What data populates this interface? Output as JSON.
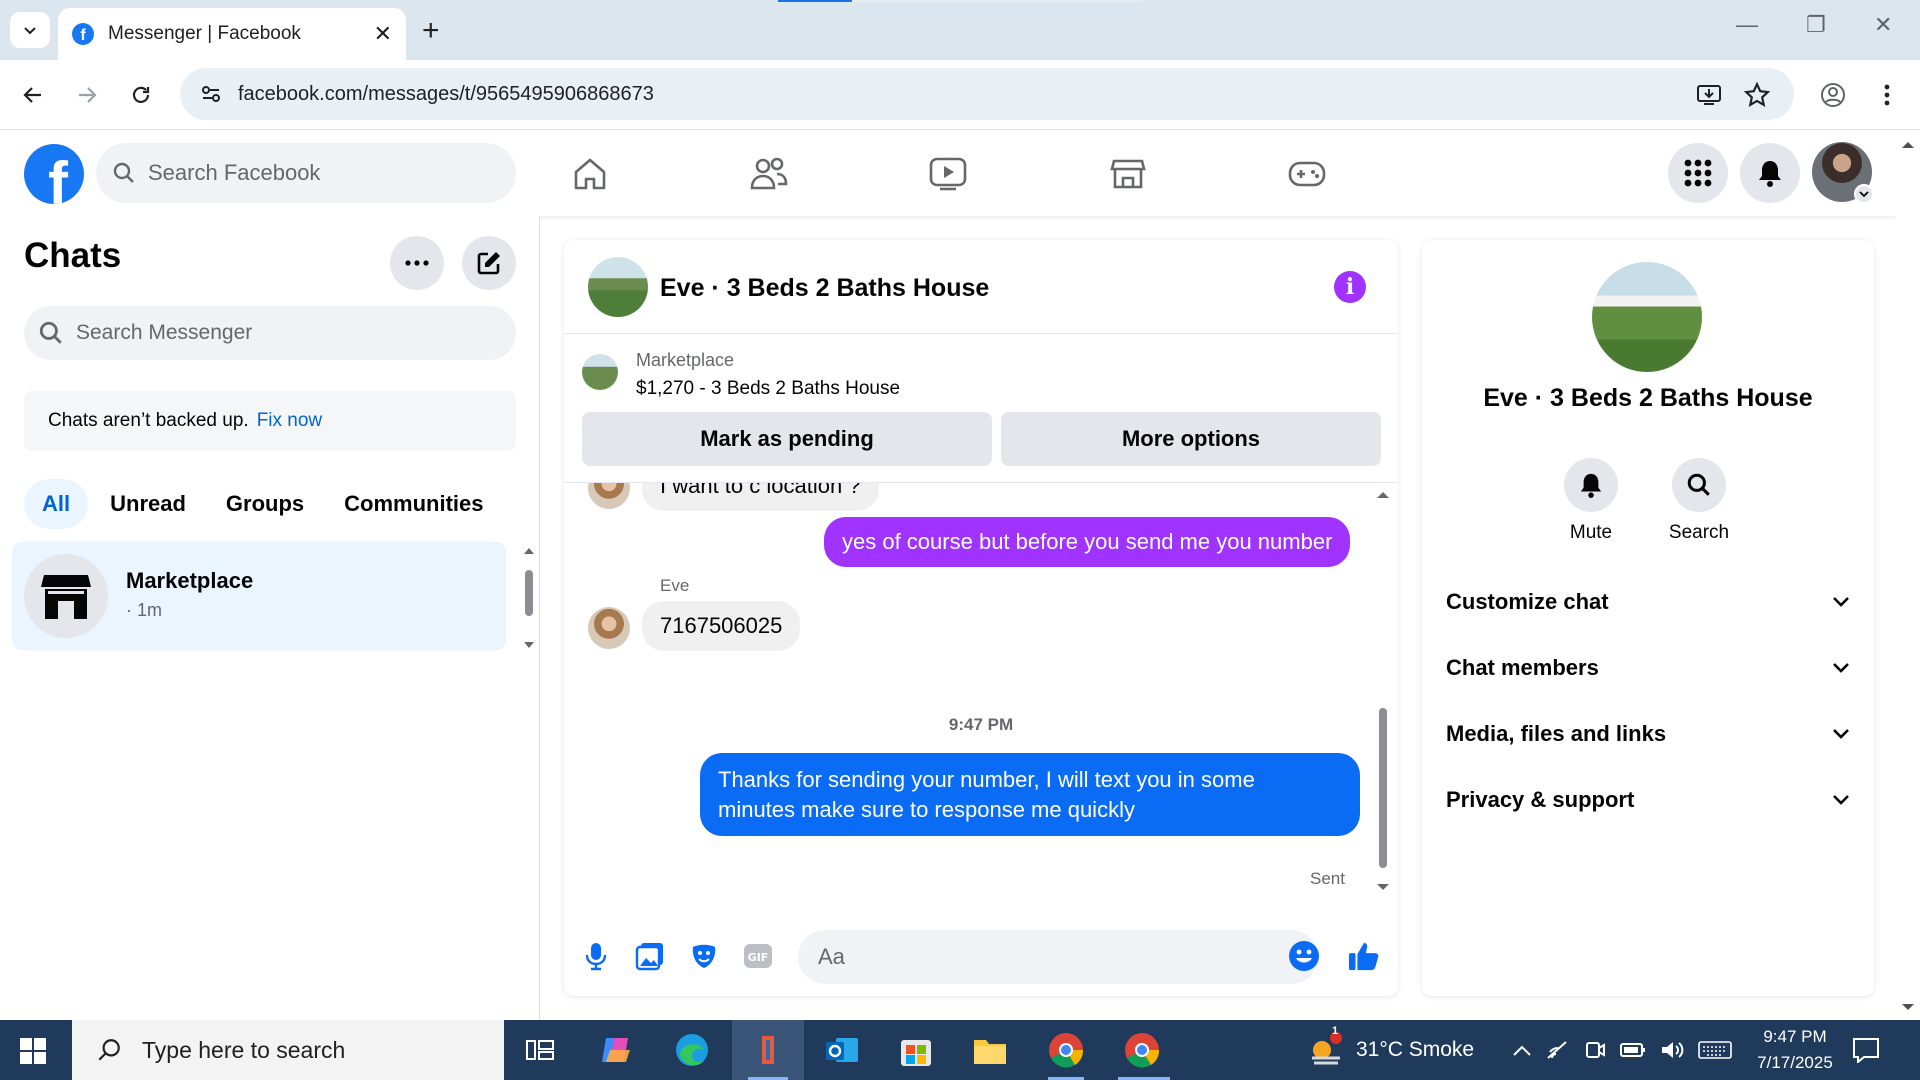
{
  "browser": {
    "tab_title": "Messenger | Facebook",
    "url": "facebook.com/messages/t/9565495906868673"
  },
  "facebook": {
    "logo_letter": "f",
    "search_placeholder": "Search Facebook"
  },
  "chats": {
    "title": "Chats",
    "search_placeholder": "Search Messenger",
    "backup_text": "Chats aren’t backed up.",
    "backup_link": "Fix now",
    "filters": [
      "All",
      "Unread",
      "Groups",
      "Communities"
    ],
    "items": [
      {
        "name": "Marketplace",
        "meta": "· 1m"
      }
    ]
  },
  "conversation": {
    "title": "Eve · 3 Beds 2 Baths House",
    "marketplace_label": "Marketplace",
    "listing": "$1,270 - 3 Beds 2 Baths House",
    "mark_pending": "Mark as pending",
    "more_options": "More options",
    "messages": [
      {
        "from": "them",
        "text": "I want to c location ?"
      },
      {
        "from": "me",
        "text": "yes of course but before you send me you number"
      },
      {
        "sender": "Eve",
        "from": "them",
        "text": "7167506025"
      },
      {
        "timestamp": "9:47 PM"
      },
      {
        "from": "me",
        "text_line1": "Thanks for sending your number, I will text you in some",
        "text_line2": "minutes make sure to response me quickly",
        "status": "Sent"
      }
    ],
    "composer_placeholder": "Aa"
  },
  "info_panel": {
    "name": "Eve · 3 Beds 2 Baths House",
    "actions": [
      "Mute",
      "Search"
    ],
    "sections": [
      "Customize chat",
      "Chat members",
      "Media, files and links",
      "Privacy & support"
    ]
  },
  "taskbar": {
    "search_placeholder": "Type here to search",
    "weather_badge": "1",
    "weather": "31°C  Smoke",
    "time": "9:47 PM",
    "date": "7/17/2025"
  },
  "colors": {
    "brand": "#1877f2",
    "accent_purple": "#a033ff",
    "accent_blue": "#0a6cf5",
    "taskbar": "#1f3a5b"
  }
}
